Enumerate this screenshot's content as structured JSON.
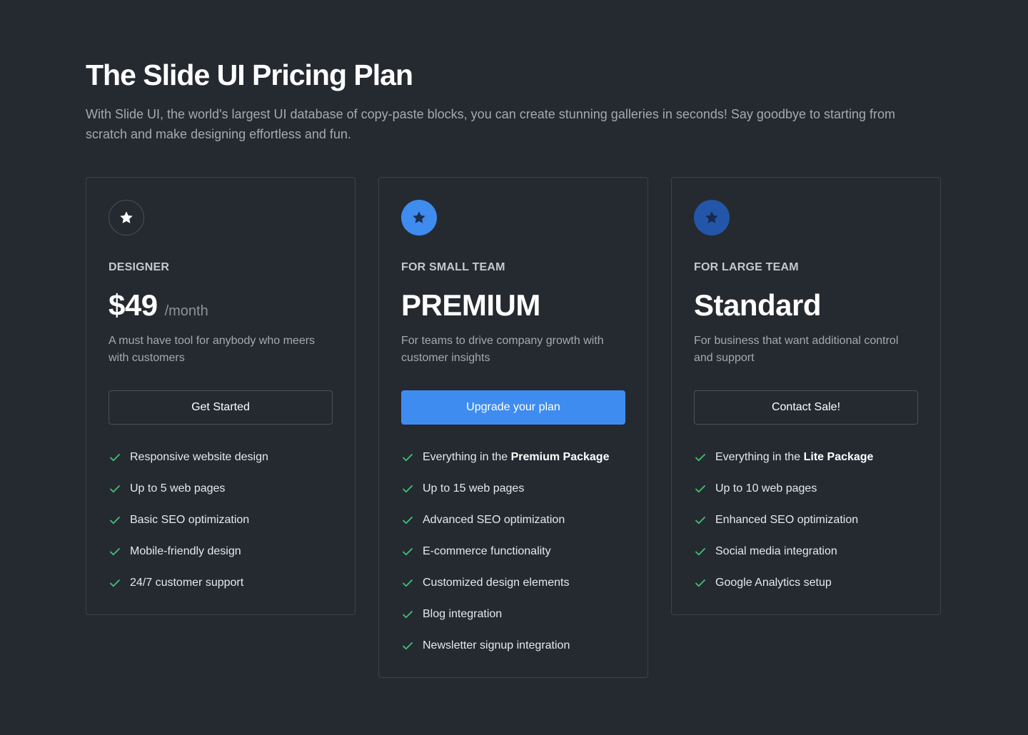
{
  "header": {
    "title": "The Slide UI Pricing Plan",
    "subtitle": "With Slide UI, the world's largest UI database of copy-paste blocks, you can create stunning galleries in seconds! Say goodbye to starting from scratch and make designing effortless and fun."
  },
  "colors": {
    "background": "#252a31",
    "card_border": "#3c424b",
    "accent_blue": "#3f8cf0",
    "navy": "#2356a8",
    "check_green": "#3ec46d"
  },
  "plans": [
    {
      "icon": "star-icon",
      "tier": "DESIGNER",
      "price": "$49",
      "period": "/month",
      "description": "A must have tool for anybody who meers with customers",
      "cta": "Get Started",
      "features": [
        "Responsive website design",
        "Up to 5 web pages",
        "Basic SEO optimization",
        "Mobile-friendly design",
        "24/7 customer support"
      ]
    },
    {
      "icon": "star-icon",
      "tier": "FOR SMALL TEAM",
      "name": "PREMIUM",
      "description": "For teams to drive company growth with customer insights",
      "cta": "Upgrade your plan",
      "features_first": {
        "prefix": "Everything in the ",
        "bold": "Premium Package"
      },
      "features": [
        "Up to 15 web pages",
        "Advanced SEO optimization",
        "E-commerce functionality",
        "Customized design elements",
        "Blog integration",
        "Newsletter signup integration"
      ]
    },
    {
      "icon": "star-icon",
      "tier": "FOR LARGE TEAM",
      "name": "Standard",
      "description": "For business that want additional control and support",
      "cta": "Contact Sale!",
      "features_first": {
        "prefix": "Everything in the ",
        "bold": "Lite Package"
      },
      "features": [
        "Up to 10 web pages",
        "Enhanced SEO optimization",
        "Social media integration",
        "Google Analytics setup"
      ]
    }
  ]
}
